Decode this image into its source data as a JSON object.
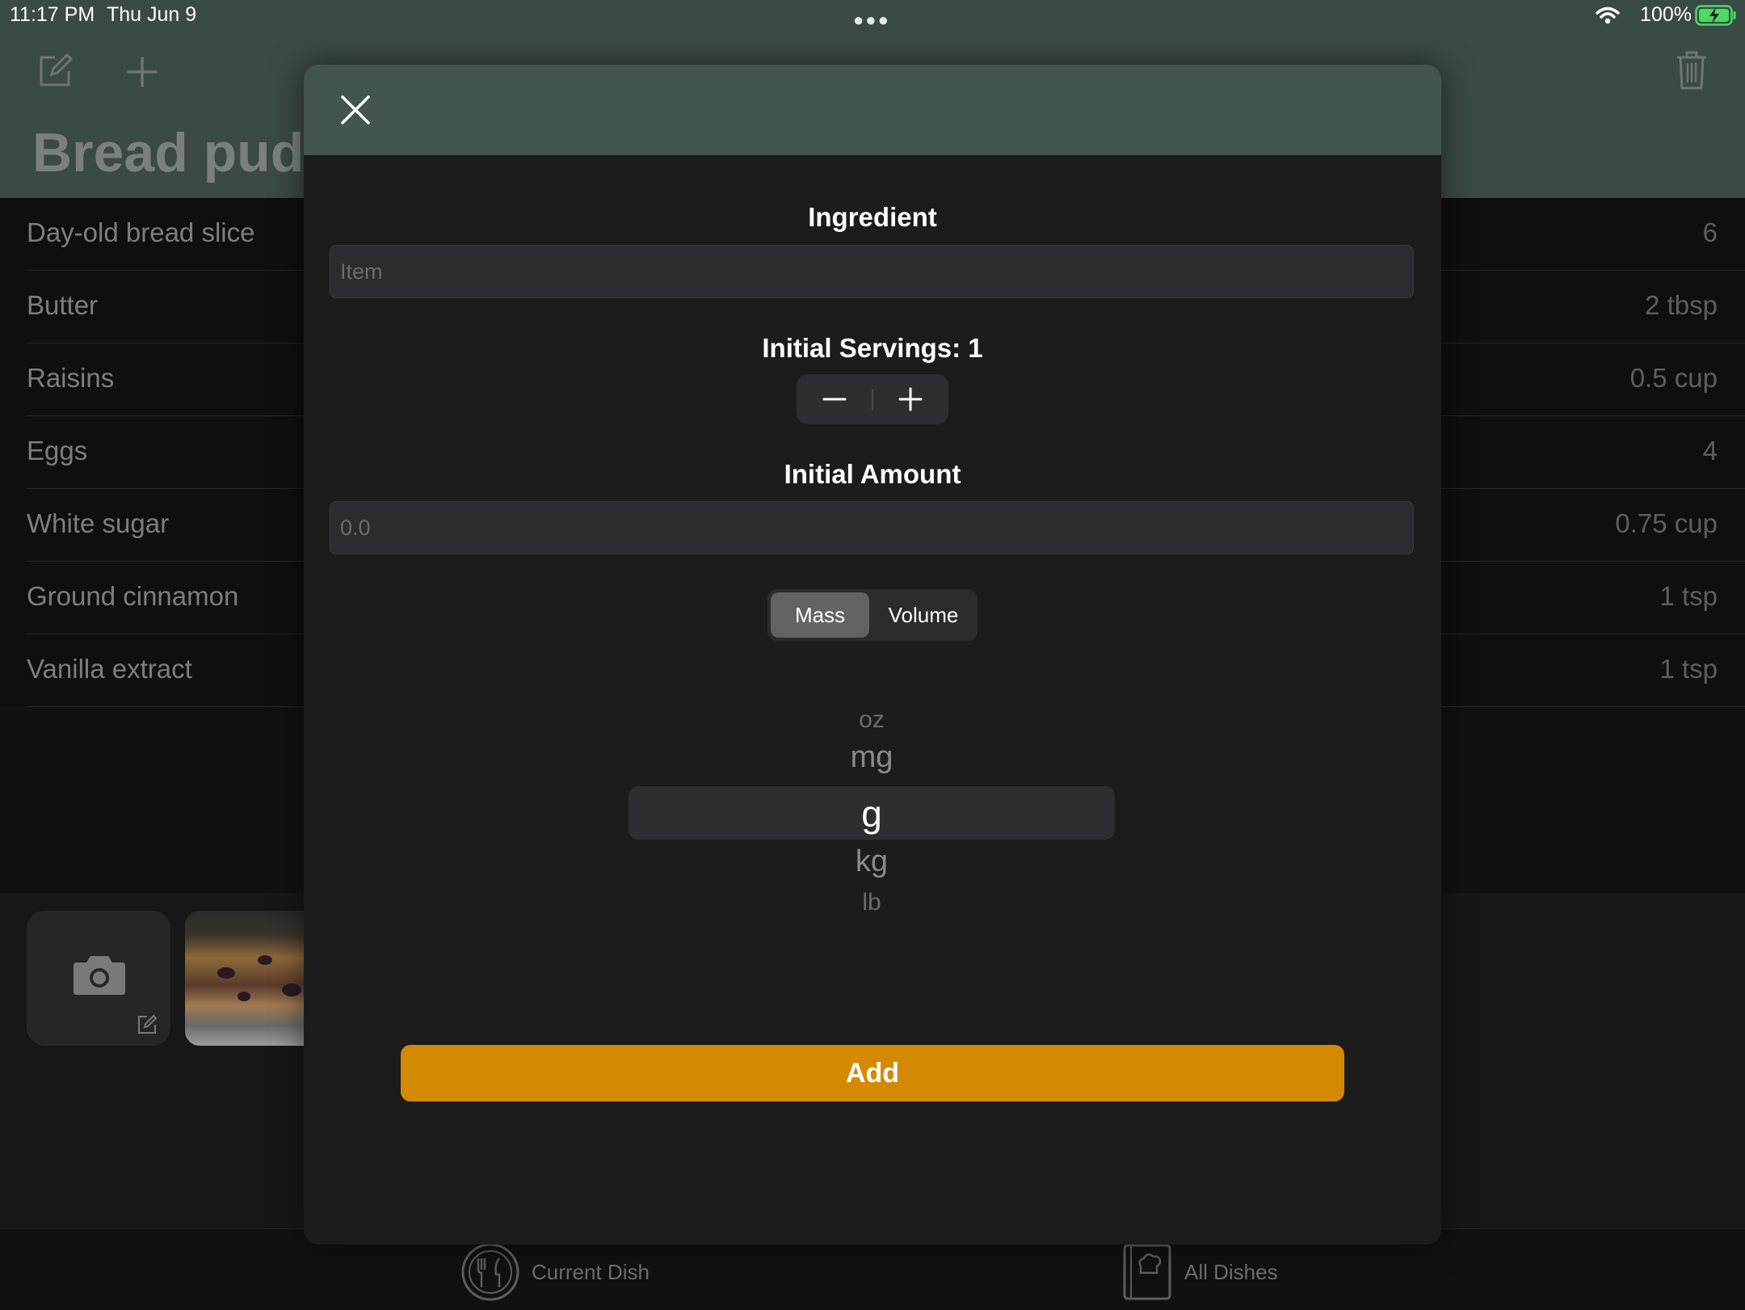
{
  "status_bar": {
    "time": "11:17 PM",
    "date": "Thu Jun 9",
    "battery": "100%"
  },
  "header": {
    "title": "Bread pudd",
    "icons": [
      "compose-icon",
      "plus-icon",
      "trash-icon"
    ]
  },
  "ingredients": [
    {
      "name": "Day-old bread slice",
      "amount": "6"
    },
    {
      "name": "Butter",
      "amount": "2 tbsp"
    },
    {
      "name": "Raisins",
      "amount": "0.5 cup"
    },
    {
      "name": "Eggs",
      "amount": "4"
    },
    {
      "name": "White sugar",
      "amount": "0.75 cup"
    },
    {
      "name": "Ground cinnamon",
      "amount": "1 tsp"
    },
    {
      "name": "Vanilla extract",
      "amount": "1 tsp"
    }
  ],
  "tab_bar": {
    "current_dish": "Current Dish",
    "all_dishes": "All Dishes"
  },
  "modal": {
    "ingredient_label": "Ingredient",
    "ingredient_placeholder": "Item",
    "servings_label": "Initial Servings: 1",
    "amount_label": "Initial Amount",
    "amount_placeholder": "0.0",
    "unit_type": {
      "options": [
        "Mass",
        "Volume"
      ],
      "selected": "Mass"
    },
    "unit_picker": {
      "items": [
        "oz",
        "mg",
        "g",
        "kg",
        "lb"
      ],
      "selected": "g"
    },
    "add_label": "Add"
  },
  "colors": {
    "header_bg": "#3a4a45",
    "modal_header_bg": "#425550",
    "accent": "#d48a00",
    "battery_green": "#4cd964"
  }
}
